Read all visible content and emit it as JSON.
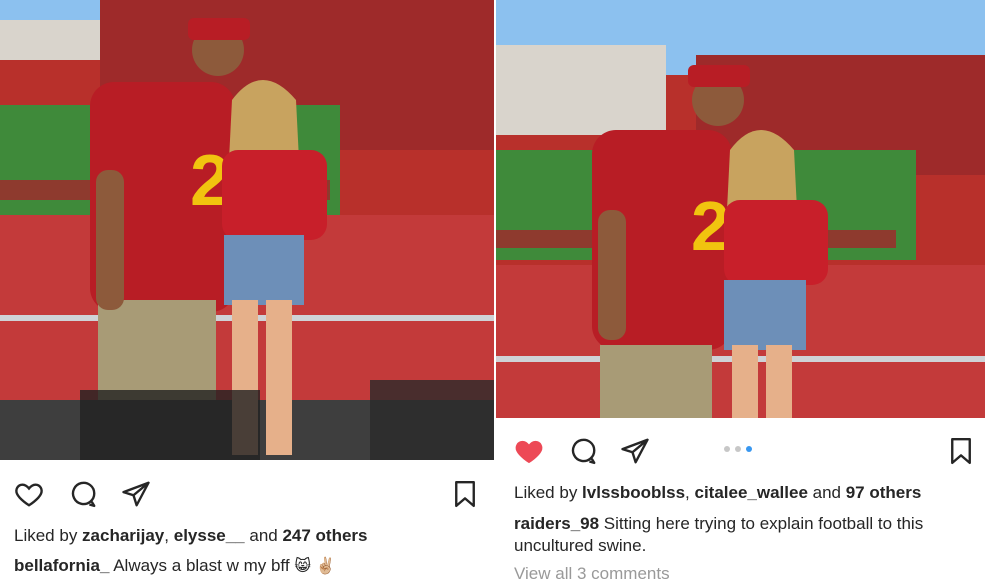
{
  "left_post": {
    "photo_alt": "",
    "liked_prefix": "Liked by ",
    "liked_user1": "zacharijay",
    "liked_sep": ", ",
    "liked_user2": "elysse__",
    "liked_and": " and ",
    "liked_others": "247 others",
    "caption_user": "bellafornia_",
    "caption_text": " Always a blast w my bff",
    "caption_emoji1": "😸",
    "caption_emoji2": "✌🏼",
    "icons": [
      "heart-icon",
      "comment-icon",
      "share-icon",
      "bookmark-icon"
    ]
  },
  "right_post": {
    "liked_prefix": "Liked by ",
    "liked_user1": "lvlssbooblss",
    "liked_sep": ", ",
    "liked_user2": "citalee_wallee",
    "liked_and": " and ",
    "liked_others": "97 others",
    "caption_user": "raiders_98",
    "caption_text": " Sitting here trying to explain football to this uncultured swine.",
    "view_comments": "View all 3 comments",
    "carousel": {
      "count": 3,
      "active": 3
    },
    "icons": [
      "heart-filled-icon",
      "comment-icon",
      "share-icon",
      "bookmark-icon"
    ]
  },
  "colors": {
    "like_red": "#ed4956",
    "carousel_active": "#3897f0",
    "jersey_red": "#b81d25",
    "field_green": "#3f8a3a",
    "sky_blue": "#7fb6e8"
  }
}
